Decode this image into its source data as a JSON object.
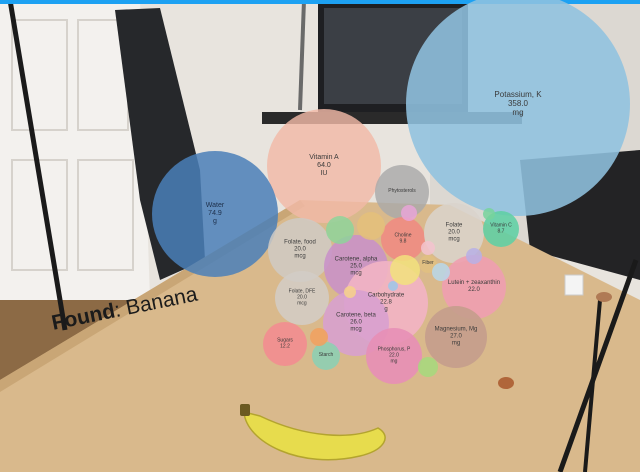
{
  "status_bar": {
    "left": "",
    "right": ""
  },
  "detection": {
    "label": "Found",
    "value": "Banana"
  },
  "nutrients": [
    {
      "name": "Potassium, K",
      "value": "358.0",
      "unit": "mg",
      "color": "#8fc1df",
      "opacity": 0.88
    },
    {
      "name": "Vitamin A",
      "value": "64.0",
      "unit": "IU",
      "color": "#f2b9a7",
      "opacity": 0.82
    },
    {
      "name": "Water",
      "value": "74.9",
      "unit": "g",
      "color": "#4a7fb8",
      "opacity": 0.85
    },
    {
      "name": "Phytosterols",
      "value": "",
      "unit": "",
      "color": "#a9a9a9",
      "opacity": 0.82
    },
    {
      "name": "Folate, food",
      "value": "20.0",
      "unit": "mcg",
      "color": "#cfcac4",
      "opacity": 0.85
    },
    {
      "name": "Choline",
      "value": "9.8",
      "unit": "",
      "color": "#ef8a82",
      "opacity": 0.88
    },
    {
      "name": "Folate",
      "value": "20.0",
      "unit": "mcg",
      "color": "#d9d3cd",
      "opacity": 0.85
    },
    {
      "name": "Vitamin C",
      "value": "8.7",
      "unit": "",
      "color": "#5fcfa4",
      "opacity": 0.88
    },
    {
      "name": "Carotene, alpha",
      "value": "25.0",
      "unit": "mcg",
      "color": "#c891c8",
      "opacity": 0.88
    },
    {
      "name": "Fiber",
      "value": "",
      "unit": "",
      "color": "#e0c080",
      "opacity": 0.85
    },
    {
      "name": "Lutein + zeaxanthin",
      "value": "22.0",
      "unit": "",
      "color": "#ee9fb0",
      "opacity": 0.9
    },
    {
      "name": "Folate, DFE",
      "value": "20.0",
      "unit": "mcg",
      "color": "#d2cdc7",
      "opacity": 0.85
    },
    {
      "name": "Carbohydrate",
      "value": "22.8",
      "unit": "g",
      "color": "#f2b4c4",
      "opacity": 0.9
    },
    {
      "name": "Carotene, beta",
      "value": "26.0",
      "unit": "mcg",
      "color": "#d79fd0",
      "opacity": 0.88
    },
    {
      "name": "Magnesium, Mg",
      "value": "27.0",
      "unit": "mg",
      "color": "#c49d8c",
      "opacity": 0.9
    },
    {
      "name": "Sugars",
      "value": "12.2",
      "unit": "",
      "color": "#f28d90",
      "opacity": 0.9
    },
    {
      "name": "Starch",
      "value": "",
      "unit": "",
      "color": "#8bcfb4",
      "opacity": 0.88
    },
    {
      "name": "Phosphorus, P",
      "value": "22.0",
      "unit": "mg",
      "color": "#e78fb6",
      "opacity": 0.9
    },
    {
      "name": "",
      "value": "",
      "unit": "",
      "color": "#8ed39a",
      "opacity": 0.85
    },
    {
      "name": "",
      "value": "",
      "unit": "",
      "color": "#e4c07a",
      "opacity": 0.85
    },
    {
      "name": "",
      "value": "",
      "unit": "",
      "color": "#f2e27c",
      "opacity": 0.85
    },
    {
      "name": "",
      "value": "",
      "unit": "",
      "color": "#b7d7ea",
      "opacity": 0.85
    },
    {
      "name": "",
      "value": "",
      "unit": "",
      "color": "#f0a060",
      "opacity": 0.88
    },
    {
      "name": "",
      "value": "",
      "unit": "",
      "color": "#a5d97d",
      "opacity": 0.85
    },
    {
      "name": "",
      "value": "",
      "unit": "",
      "color": "#b7b0e6",
      "opacity": 0.85
    },
    {
      "name": "",
      "value": "",
      "unit": "",
      "color": "#77d49c",
      "opacity": 0.85
    },
    {
      "name": "",
      "value": "",
      "unit": "",
      "color": "#f3c3cf",
      "opacity": 0.85
    },
    {
      "name": "",
      "value": "",
      "unit": "",
      "color": "#9cc7e8",
      "opacity": 0.85
    },
    {
      "name": "",
      "value": "",
      "unit": "",
      "color": "#e7a5d8",
      "opacity": 0.85
    },
    {
      "name": "",
      "value": "",
      "unit": "",
      "color": "#f6d28a",
      "opacity": 0.85
    }
  ]
}
